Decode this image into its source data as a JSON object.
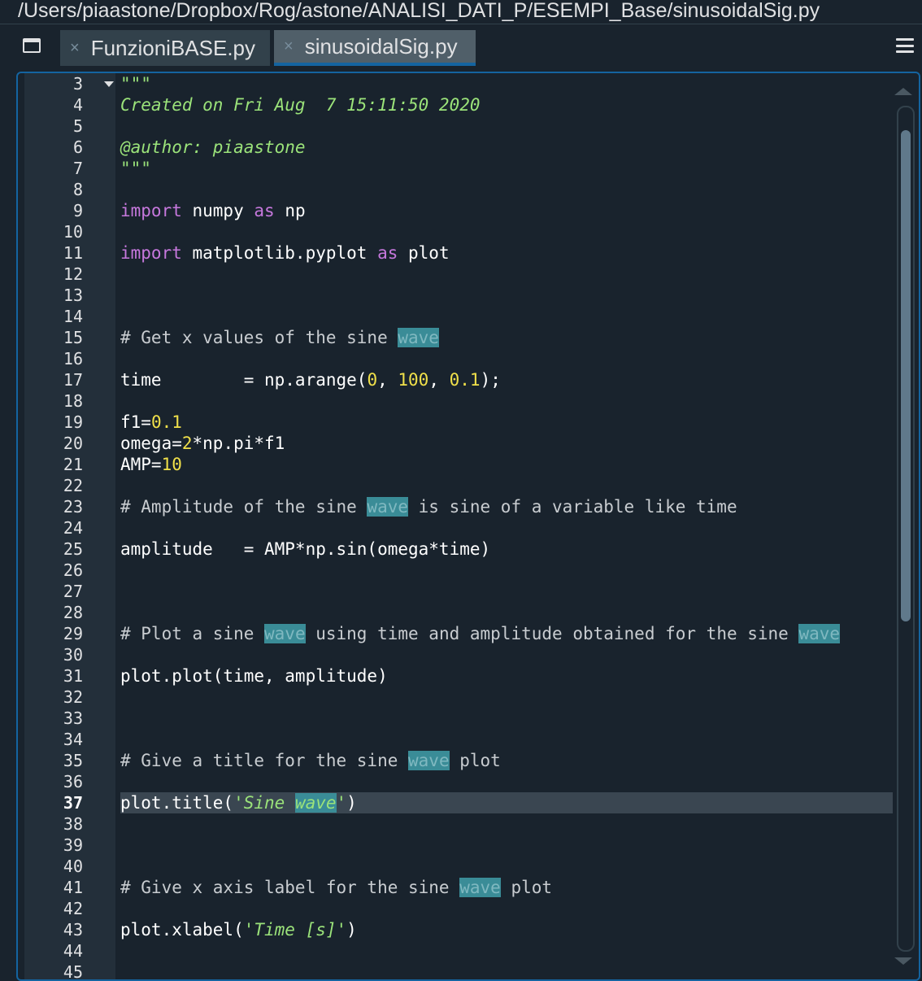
{
  "window": {
    "path": "/Users/piaastone/Dropbox/Rog/astone/ANALISI_DATI_P/ESEMPI_Base/sinusoidalSig.py"
  },
  "tabs": [
    {
      "label": "FunzioniBASE.py",
      "close": "×",
      "active": false
    },
    {
      "label": "sinusoidalSig.py",
      "close": "×",
      "active": true
    }
  ],
  "icons": {
    "window_icon": "window-icon",
    "menu_icon": "hamburger-menu-icon",
    "fold": "fold-arrow-icon"
  },
  "colors": {
    "background": "#19232d",
    "accent": "#1464a0",
    "keyword": "#c678dd",
    "number": "#f0e04a",
    "string": "#9be37a",
    "highlight": "#3a8c97"
  },
  "editor": {
    "current_line": "37",
    "line_numbers": [
      "3",
      "4",
      "5",
      "6",
      "7",
      "8",
      "9",
      "10",
      "11",
      "12",
      "13",
      "14",
      "15",
      "16",
      "17",
      "18",
      "19",
      "20",
      "21",
      "22",
      "23",
      "24",
      "25",
      "26",
      "27",
      "28",
      "29",
      "30",
      "31",
      "32",
      "33",
      "34",
      "35",
      "36",
      "37",
      "38",
      "39",
      "40",
      "41",
      "42",
      "43",
      "44",
      "45"
    ],
    "code": {
      "l3": "\"\"\"",
      "l4": "Created on Fri Aug  7 15:11:50 2020",
      "l6": "@author: piaastone",
      "l7": "\"\"\"",
      "l9_kw1": "import",
      "l9_mod": " numpy ",
      "l9_kw2": "as",
      "l9_alias": " np",
      "l11_kw1": "import",
      "l11_mod": " matplotlib.pyplot ",
      "l11_kw2": "as",
      "l11_alias": " plot",
      "l15_com": "# Get x values of the sine ",
      "l15_hl": "wave",
      "l17_a": "time        = np.arange(",
      "l17_n1": "0",
      "l17_b": ", ",
      "l17_n2": "100",
      "l17_c": ", ",
      "l17_n3": "0.1",
      "l17_d": ");",
      "l19_a": "f1=",
      "l19_n": "0.1",
      "l20_a": "omega=",
      "l20_n": "2",
      "l20_b": "*np.pi*f1",
      "l21_a": "AMP=",
      "l21_n": "10",
      "l23_com1": "# Amplitude of the sine ",
      "l23_hl": "wave",
      "l23_com2": " is sine of a variable like time",
      "l25": "amplitude   = AMP*np.sin(omega*time)",
      "l29_com1": "# Plot a sine ",
      "l29_hl1": "wave",
      "l29_com2": " using time and amplitude obtained for the sine ",
      "l29_hl2": "wave",
      "l31": "plot.plot(time, amplitude)",
      "l35_com1": "# Give a title for the sine ",
      "l35_hl": "wave",
      "l35_com2": " plot",
      "l37_a": "plot.title(",
      "l37_q1": "'Sine ",
      "l37_hl": "wave",
      "l37_q2": "'",
      "l37_b": ")",
      "l41_com1": "# Give x axis label for the sine ",
      "l41_hl": "wave",
      "l41_com2": " plot",
      "l43_a": "plot.xlabel(",
      "l43_s": "'Time [s]'",
      "l43_b": ")"
    }
  }
}
